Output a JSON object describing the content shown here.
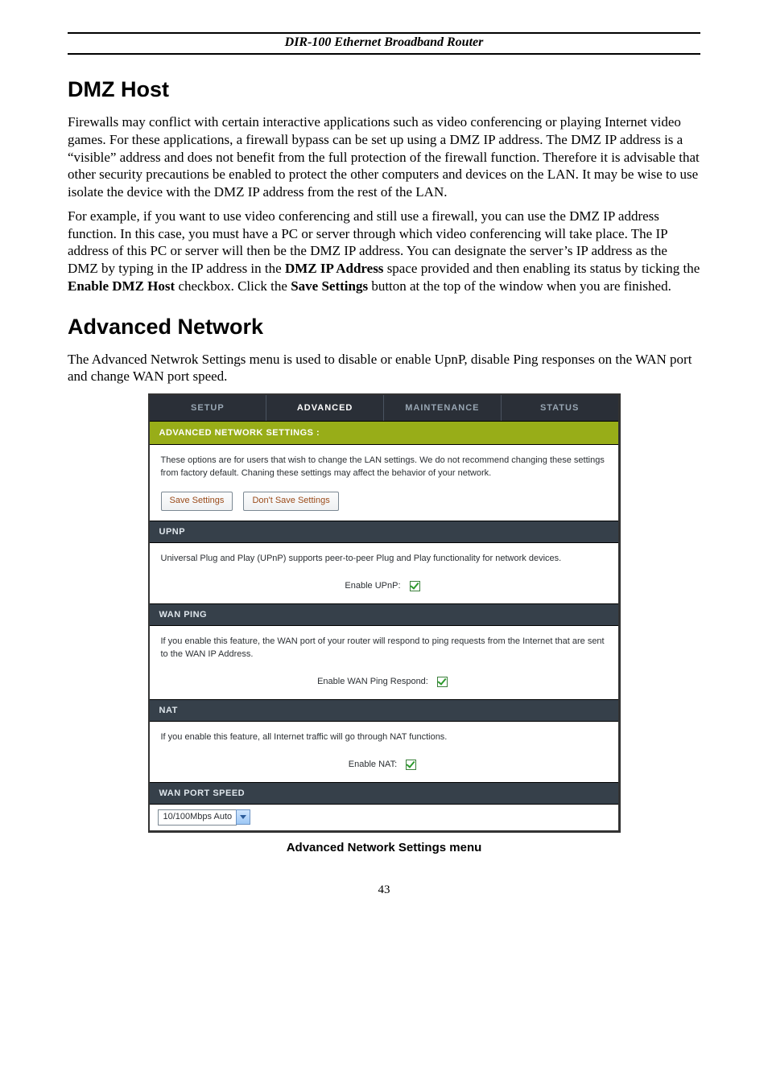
{
  "page_header": "DIR-100 Ethernet Broadband Router",
  "section_dmz": {
    "heading": "DMZ Host",
    "para1": "Firewalls may conflict with certain interactive applications such as video conferencing or playing Internet video games. For these applications, a firewall bypass can be set up using a DMZ IP address. The DMZ IP address is a “visible” address and does not benefit from the full protection of the firewall function. Therefore it is advisable that other security precautions be enabled to protect the other computers and devices on the LAN. It may be wise to use isolate the device with the DMZ IP address from the rest of the LAN.",
    "para2_pre": "For example, if you want to use video conferencing and still use a firewall, you can use the DMZ IP address function. In this case, you must have a PC or server through which video conferencing will take place. The IP address of this PC or server will then be the DMZ IP address. You can designate the server’s IP address as the DMZ by typing in the IP address in the ",
    "para2_b1": "DMZ IP Address",
    "para2_mid1": " space provided and then enabling its status by ticking the ",
    "para2_b2": "Enable DMZ Host",
    "para2_mid2": " checkbox. Click the ",
    "para2_b3": "Save Settings",
    "para2_post": " button at the top of the window when you are finished."
  },
  "section_adv": {
    "heading": "Advanced Network",
    "intro": "The Advanced Netwrok Settings menu is used to disable or enable UpnP, disable Ping responses on the WAN port and change WAN port speed."
  },
  "shot": {
    "tabs": [
      "SETUP",
      "ADVANCED",
      "MAINTENANCE",
      "STATUS"
    ],
    "active_tab_index": 1,
    "title_band": "ADVANCED NETWORK SETTINGS :",
    "intro_text": "These options are for users that wish to change the LAN settings. We do not recommend changing these settings from factory default. Chaning these settings may affect the behavior of your network.",
    "btn_save": "Save Settings",
    "btn_dont": "Don't Save Settings",
    "upnp_band": "UPNP",
    "upnp_text": "Universal Plug and Play (UPnP) supports peer-to-peer Plug and Play functionality for network devices.",
    "upnp_label": "Enable UPnP:",
    "wanping_band": "WAN PING",
    "wanping_text": "If you enable this feature, the WAN port of your router will respond to ping requests from the Internet that are sent to the WAN IP Address.",
    "wanping_label": "Enable WAN Ping Respond:",
    "nat_band": "NAT",
    "nat_text": "If you enable this feature, all Internet traffic will go through NAT functions.",
    "nat_label": "Enable NAT:",
    "wanspeed_band": "WAN PORT SPEED",
    "wanspeed_value": "10/100Mbps Auto"
  },
  "caption": "Advanced Network Settings menu",
  "page_number": "43"
}
